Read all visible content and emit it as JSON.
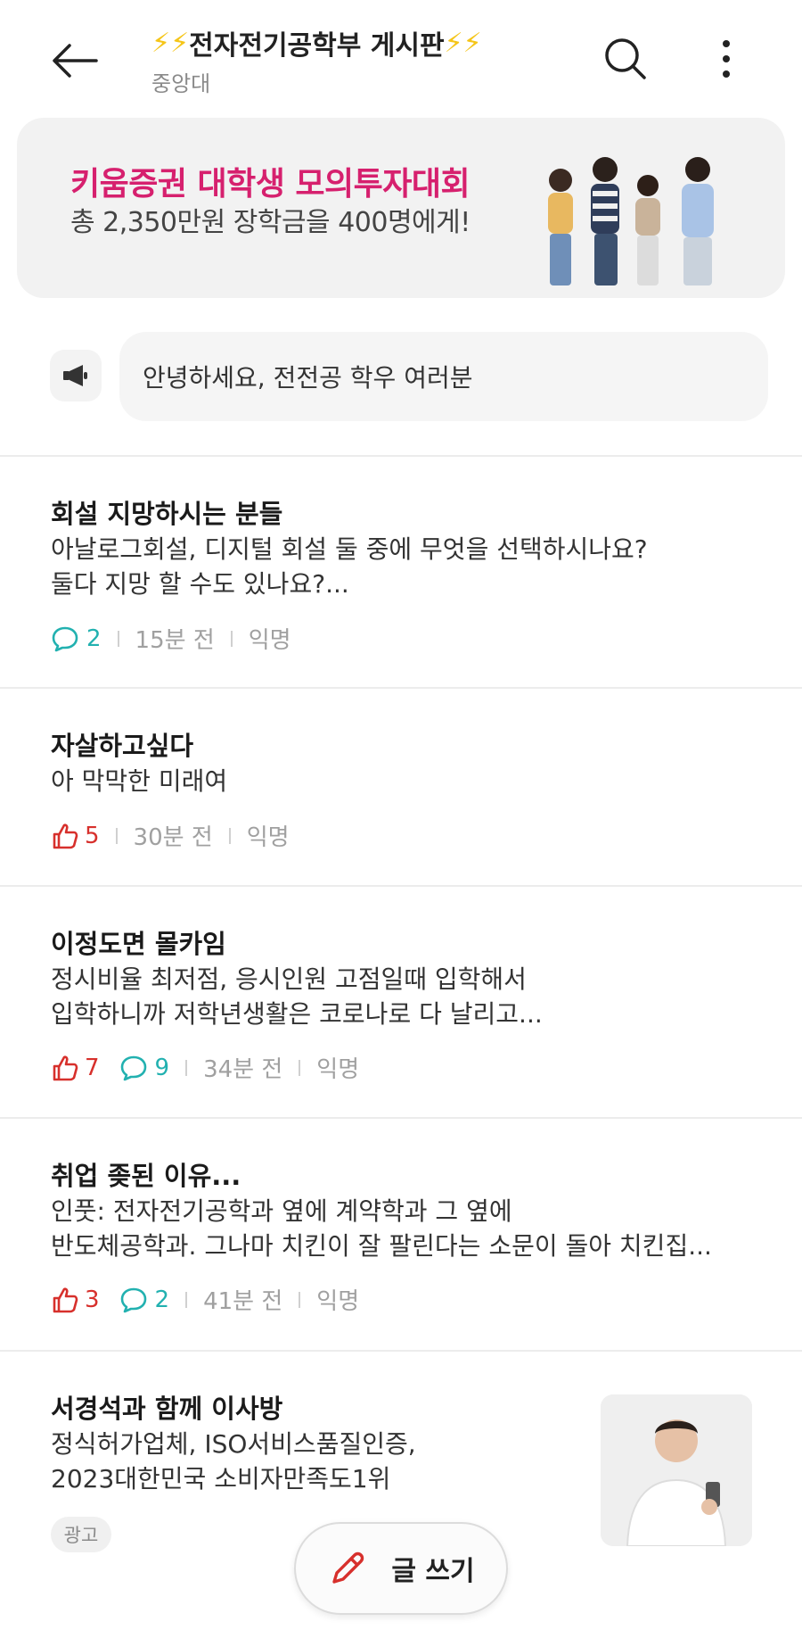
{
  "header": {
    "title_left_emoji": "⚡⚡",
    "title": "전자전기공학부 게시판",
    "title_right_emoji": "⚡⚡",
    "subtitle": "중앙대"
  },
  "banner": {
    "title": "키움증권 대학생 모의투자대회",
    "subtitle": "총 2,350만원 장학금을 400명에게!",
    "accent_color": "#d6206e"
  },
  "notice": {
    "icon": "megaphone-icon",
    "text": "안녕하세요, 전전공 학우 여러분"
  },
  "posts": [
    {
      "title": "회설 지망하시는 분들",
      "body": [
        "아날로그회설, 디지털 회설 둘 중에 무엇을 선택하시나요?",
        "둘다 지망 할 수도 있나요?..."
      ],
      "comments": "2",
      "time": "15분 전",
      "author": "익명"
    },
    {
      "title": "자살하고싶다",
      "body": [
        "아 막막한 미래여"
      ],
      "likes": "5",
      "time": "30분 전",
      "author": "익명"
    },
    {
      "title": "이정도면 몰카임",
      "body": [
        "정시비율 최저점, 응시인원 고점일때 입학해서",
        "입학하니까 저학년생활은 코로나로 다 날리고..."
      ],
      "likes": "7",
      "comments": "9",
      "time": "34분 전",
      "author": "익명"
    },
    {
      "title": "취업 좆된 이유...",
      "body": [
        "인풋: 전자전기공학과 옆에 계약학과 그 옆에",
        "반도체공학과. 그나마 치킨이 잘 팔린다는 소문이 돌아 치킨집..."
      ],
      "likes": "3",
      "comments": "2",
      "time": "41분 전",
      "author": "익명"
    }
  ],
  "ad": {
    "title": "서경석과 함께 이사방",
    "body": [
      "정식허가업체, ISO서비스품질인증,",
      "2023대한민국 소비자만족도1위"
    ],
    "badge": "광고"
  },
  "write_button": {
    "label": "글 쓰기",
    "icon": "pencil-icon"
  },
  "colors": {
    "like": "#d7302c",
    "comment": "#22b1b0"
  }
}
